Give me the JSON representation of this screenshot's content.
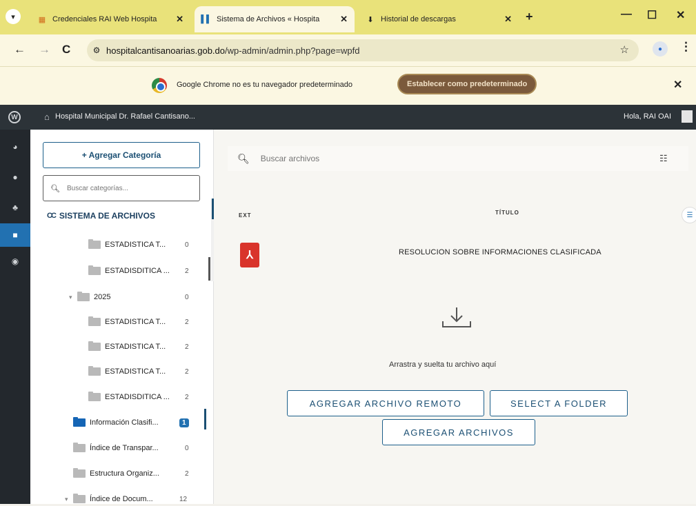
{
  "browser": {
    "tabs": [
      {
        "title": "Credenciales RAI Web Hospita",
        "icon": "sheets-icon",
        "active": false
      },
      {
        "title": "Sistema de Archivos « Hospita",
        "icon": "file-manager-icon",
        "active": true
      },
      {
        "title": "Historial de descargas",
        "icon": "download-icon",
        "active": false
      }
    ],
    "url_host": "hospitalcantisanoarias.gob.do",
    "url_path": "/wp-admin/admin.php?page=wpfd",
    "infobar_message": "Google Chrome no es tu navegador predeterminado",
    "infobar_button": "Establecer como predeterminado"
  },
  "wp_adminbar": {
    "site_name": "Hospital Municipal Dr. Rafael Cantisano...",
    "greeting": "Hola, RAI OAI"
  },
  "categories": {
    "add_button": "+ Agregar Categoría",
    "search_placeholder": "Buscar categorías...",
    "root_label": "SISTEMA DE ARCHIVOS",
    "items": [
      {
        "name": "ESTADISTICA T...",
        "count": "0",
        "level": 3
      },
      {
        "name": "ESTADISDITICA ...",
        "count": "2",
        "level": 3
      },
      {
        "name": "2025",
        "count": "0",
        "level": 2,
        "caret": true
      },
      {
        "name": "ESTADISTICA T...",
        "count": "2",
        "level": 3
      },
      {
        "name": "ESTADISTICA T...",
        "count": "2",
        "level": 3
      },
      {
        "name": "ESTADISTICA T...",
        "count": "2",
        "level": 3
      },
      {
        "name": "ESTADISDITICA ...",
        "count": "2",
        "level": 3
      },
      {
        "name": "Información Clasifi...",
        "count": "1",
        "level": 1,
        "active": true
      },
      {
        "name": "Índice de Transpar...",
        "count": "0",
        "level": 1
      },
      {
        "name": "Estructura Organiz...",
        "count": "2",
        "level": 1
      },
      {
        "name": "Índice de Docum...",
        "count": "12",
        "level": 1,
        "caret": true
      }
    ]
  },
  "files": {
    "search_placeholder": "Buscar archivos",
    "col_ext": "EXT",
    "col_title": "TÍTULO",
    "rows": [
      {
        "ext_icon": "pdf-icon",
        "title": "RESOLUCION SOBRE INFORMACIONES CLASIFICADA"
      }
    ],
    "drop_text": "Arrastra y suelta tu archivo aquí",
    "btn_remote": "AGREGAR ARCHIVO REMOTO",
    "btn_folder": "SELECT A FOLDER",
    "btn_add": "AGREGAR ARCHIVOS"
  },
  "colors": {
    "tabstrip": "#e9e27a",
    "wp_admin_dark": "#2c3338",
    "wp_accent": "#2271b1",
    "pdf_red": "#d9342b"
  }
}
